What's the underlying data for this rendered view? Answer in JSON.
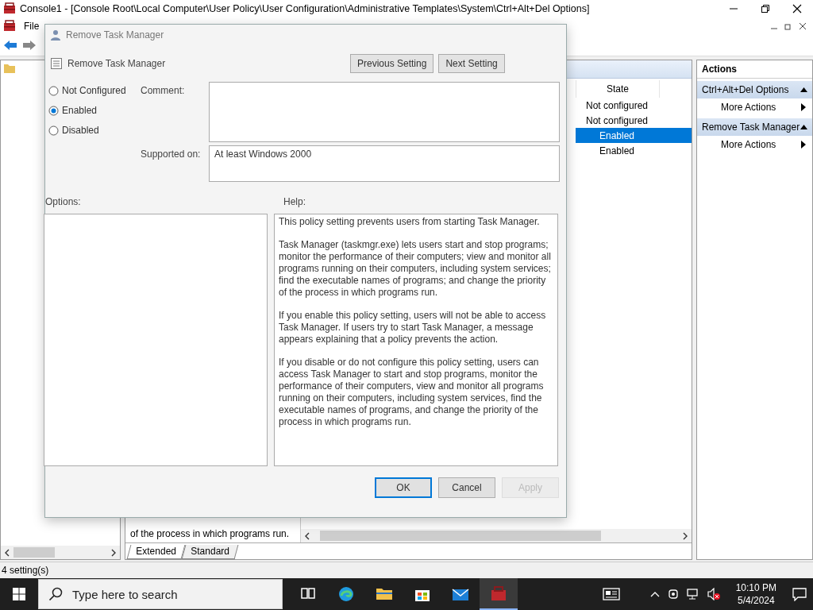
{
  "window": {
    "title": "Console1 - [Console Root\\Local Computer\\User Policy\\User Configuration\\Administrative Templates\\System\\Ctrl+Alt+Del Options]"
  },
  "menu": [
    "File"
  ],
  "settings_list": {
    "columns": [
      "State"
    ],
    "rows": [
      {
        "state": "Not configured",
        "selected": false
      },
      {
        "state": "Not configured",
        "selected": false
      },
      {
        "state": "Enabled",
        "selected": true
      },
      {
        "state": "Enabled",
        "selected": false
      }
    ]
  },
  "description_tail": "of the process in which programs run.",
  "view_tabs": [
    {
      "label": "Extended",
      "selected": true
    },
    {
      "label": "Standard",
      "selected": false
    }
  ],
  "actions": {
    "title": "Actions",
    "groups": [
      {
        "title": "Ctrl+Alt+Del Options",
        "items": [
          "More Actions"
        ]
      },
      {
        "title": "Remove Task Manager",
        "items": [
          "More Actions"
        ]
      }
    ]
  },
  "status_bar": "4 setting(s)",
  "dialog": {
    "title": "Remove Task Manager",
    "setting_name": "Remove Task Manager",
    "nav_buttons": [
      "Previous Setting",
      "Next Setting"
    ],
    "options": [
      {
        "label": "Not Configured",
        "selected": false
      },
      {
        "label": "Enabled",
        "selected": true
      },
      {
        "label": "Disabled",
        "selected": false
      }
    ],
    "comment_label": "Comment:",
    "supported_label": "Supported on:",
    "supported_value": "At least Windows 2000",
    "options_label": "Options:",
    "help_label": "Help:",
    "help": [
      "This policy setting prevents users from starting Task Manager.",
      "Task Manager (taskmgr.exe) lets users start and stop programs; monitor the performance of their computers; view and monitor all programs running on their computers, including system services; find the executable names of programs; and change the priority of the process in which programs run.",
      "If you enable this policy setting, users will not be able to access Task Manager. If users try to start Task Manager, a message appears explaining that a policy prevents the action.",
      "If you disable or do not configure this policy setting, users can access Task Manager to start and stop programs, monitor the performance of their computers, view and monitor all programs running on their computers, including system services, find the executable names of programs, and change the priority of the process in which programs run."
    ],
    "buttons": [
      {
        "label": "OK",
        "default": true,
        "disabled": false
      },
      {
        "label": "Cancel",
        "default": false,
        "disabled": false
      },
      {
        "label": "Apply",
        "default": false,
        "disabled": true
      }
    ]
  },
  "taskbar": {
    "search_placeholder": "Type here to search",
    "apps": [
      {
        "kind": "task-view",
        "active": false
      },
      {
        "kind": "browser",
        "active": false
      },
      {
        "kind": "folder",
        "active": false
      },
      {
        "kind": "store",
        "active": false
      },
      {
        "kind": "mail",
        "active": false
      },
      {
        "kind": "console",
        "active": true
      }
    ],
    "time": "10:10 PM",
    "date": "5/4/2024"
  }
}
